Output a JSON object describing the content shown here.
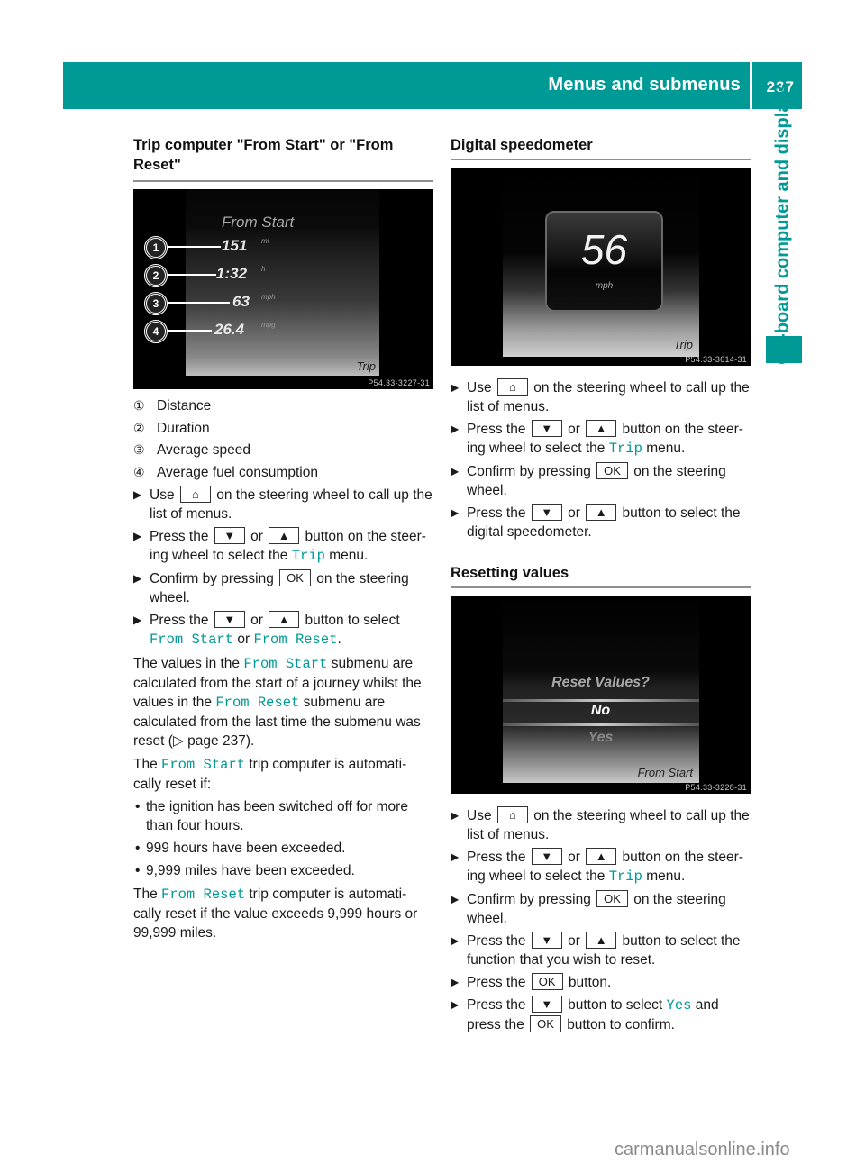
{
  "header": {
    "title": "Menus and submenus",
    "page_number": "237",
    "accent_color": "#009a96"
  },
  "side_tab": {
    "label": "On-board computer and displays"
  },
  "icons": {
    "home": "⌂",
    "down": "▼",
    "up": "▲",
    "ok": "OK",
    "step_arrow": "▶",
    "page_ref": "▷",
    "bullet": "•"
  },
  "left": {
    "heading": "Trip computer \"From Start\" or \"From Reset\"",
    "screen": {
      "title": "From Start",
      "rows": [
        {
          "num": "1",
          "value": "151",
          "unit": "mi"
        },
        {
          "num": "2",
          "value": "1:32",
          "unit": "h"
        },
        {
          "num": "3",
          "value": "63",
          "unit": "mph"
        },
        {
          "num": "4",
          "value": "26.4",
          "unit": "mpg"
        }
      ],
      "menu_label": "Trip",
      "ref": "P54.33-3227-31"
    },
    "legend": [
      {
        "num": "①",
        "label": "Distance"
      },
      {
        "num": "②",
        "label": "Duration"
      },
      {
        "num": "③",
        "label": "Average speed"
      },
      {
        "num": "④",
        "label": "Average fuel consumption"
      }
    ],
    "steps": {
      "s1_a": "Use",
      "s1_b": "on the steering wheel to call up the list of menus.",
      "s2_a": "Press the",
      "s2_or": "or",
      "s2_b": "button on the steer-ing wheel to select the",
      "s2_menu": "Trip",
      "s2_c": "menu.",
      "s3_a": "Confirm by pressing",
      "s3_b": "on the steering wheel.",
      "s4_a": "Press the",
      "s4_or": "or",
      "s4_b": "button to select",
      "s4_m1": "From Start",
      "s4_or2": "or",
      "s4_m2": "From Reset",
      "s4_end": "."
    },
    "para1": {
      "a": "The values in the",
      "m1": "From Start",
      "b": "submenu are calculated from the start of a journey whilst the values in the",
      "m2": "From Reset",
      "c": "submenu are calculated from the last time the submenu was reset (",
      "ref": "page 237",
      "d": ")."
    },
    "para2": {
      "a": "The",
      "m": "From Start",
      "b": "trip computer is automati-cally reset if:"
    },
    "bullets": [
      "the ignition has been switched off for more than four hours.",
      "999 hours have been exceeded.",
      "9,999 miles have been exceeded."
    ],
    "para3": {
      "a": "The",
      "m": "From Reset",
      "b": "trip computer is automati-cally reset if the value exceeds 9,999 hours or 99,999 miles."
    }
  },
  "right": {
    "speedo": {
      "heading": "Digital speedometer",
      "screen": {
        "value": "56",
        "unit": "mph",
        "menu_label": "Trip",
        "ref": "P54.33-3614-31"
      },
      "steps": {
        "s1_a": "Use",
        "s1_b": "on the steering wheel to call up the list of menus.",
        "s2_a": "Press the",
        "s2_or": "or",
        "s2_b": "button on the steer-ing wheel to select the",
        "s2_menu": "Trip",
        "s2_c": "menu.",
        "s3_a": "Confirm by pressing",
        "s3_b": "on the steering wheel.",
        "s4_a": "Press the",
        "s4_or": "or",
        "s4_b": "button to select the digital speedometer."
      }
    },
    "reset": {
      "heading": "Resetting values",
      "screen": {
        "question": "Reset Values?",
        "option_no": "No",
        "option_yes": "Yes",
        "menu_label": "From Start",
        "ref": "P54.33-3228-31"
      },
      "steps": {
        "s1_a": "Use",
        "s1_b": "on the steering wheel to call up the list of menus.",
        "s2_a": "Press the",
        "s2_or": "or",
        "s2_b": "button on the steer-ing wheel to select the",
        "s2_menu": "Trip",
        "s2_c": "menu.",
        "s3_a": "Confirm by pressing",
        "s3_b": "on the steering wheel.",
        "s4_a": "Press the",
        "s4_or": "or",
        "s4_b": "button to select the function that you wish to reset.",
        "s5_a": "Press the",
        "s5_b": "button.",
        "s6_a": "Press the",
        "s6_b": "button to select",
        "s6_m": "Yes",
        "s6_c": "and press the",
        "s6_d": "button to confirm."
      }
    }
  },
  "watermark": "carmanualsonline.info"
}
